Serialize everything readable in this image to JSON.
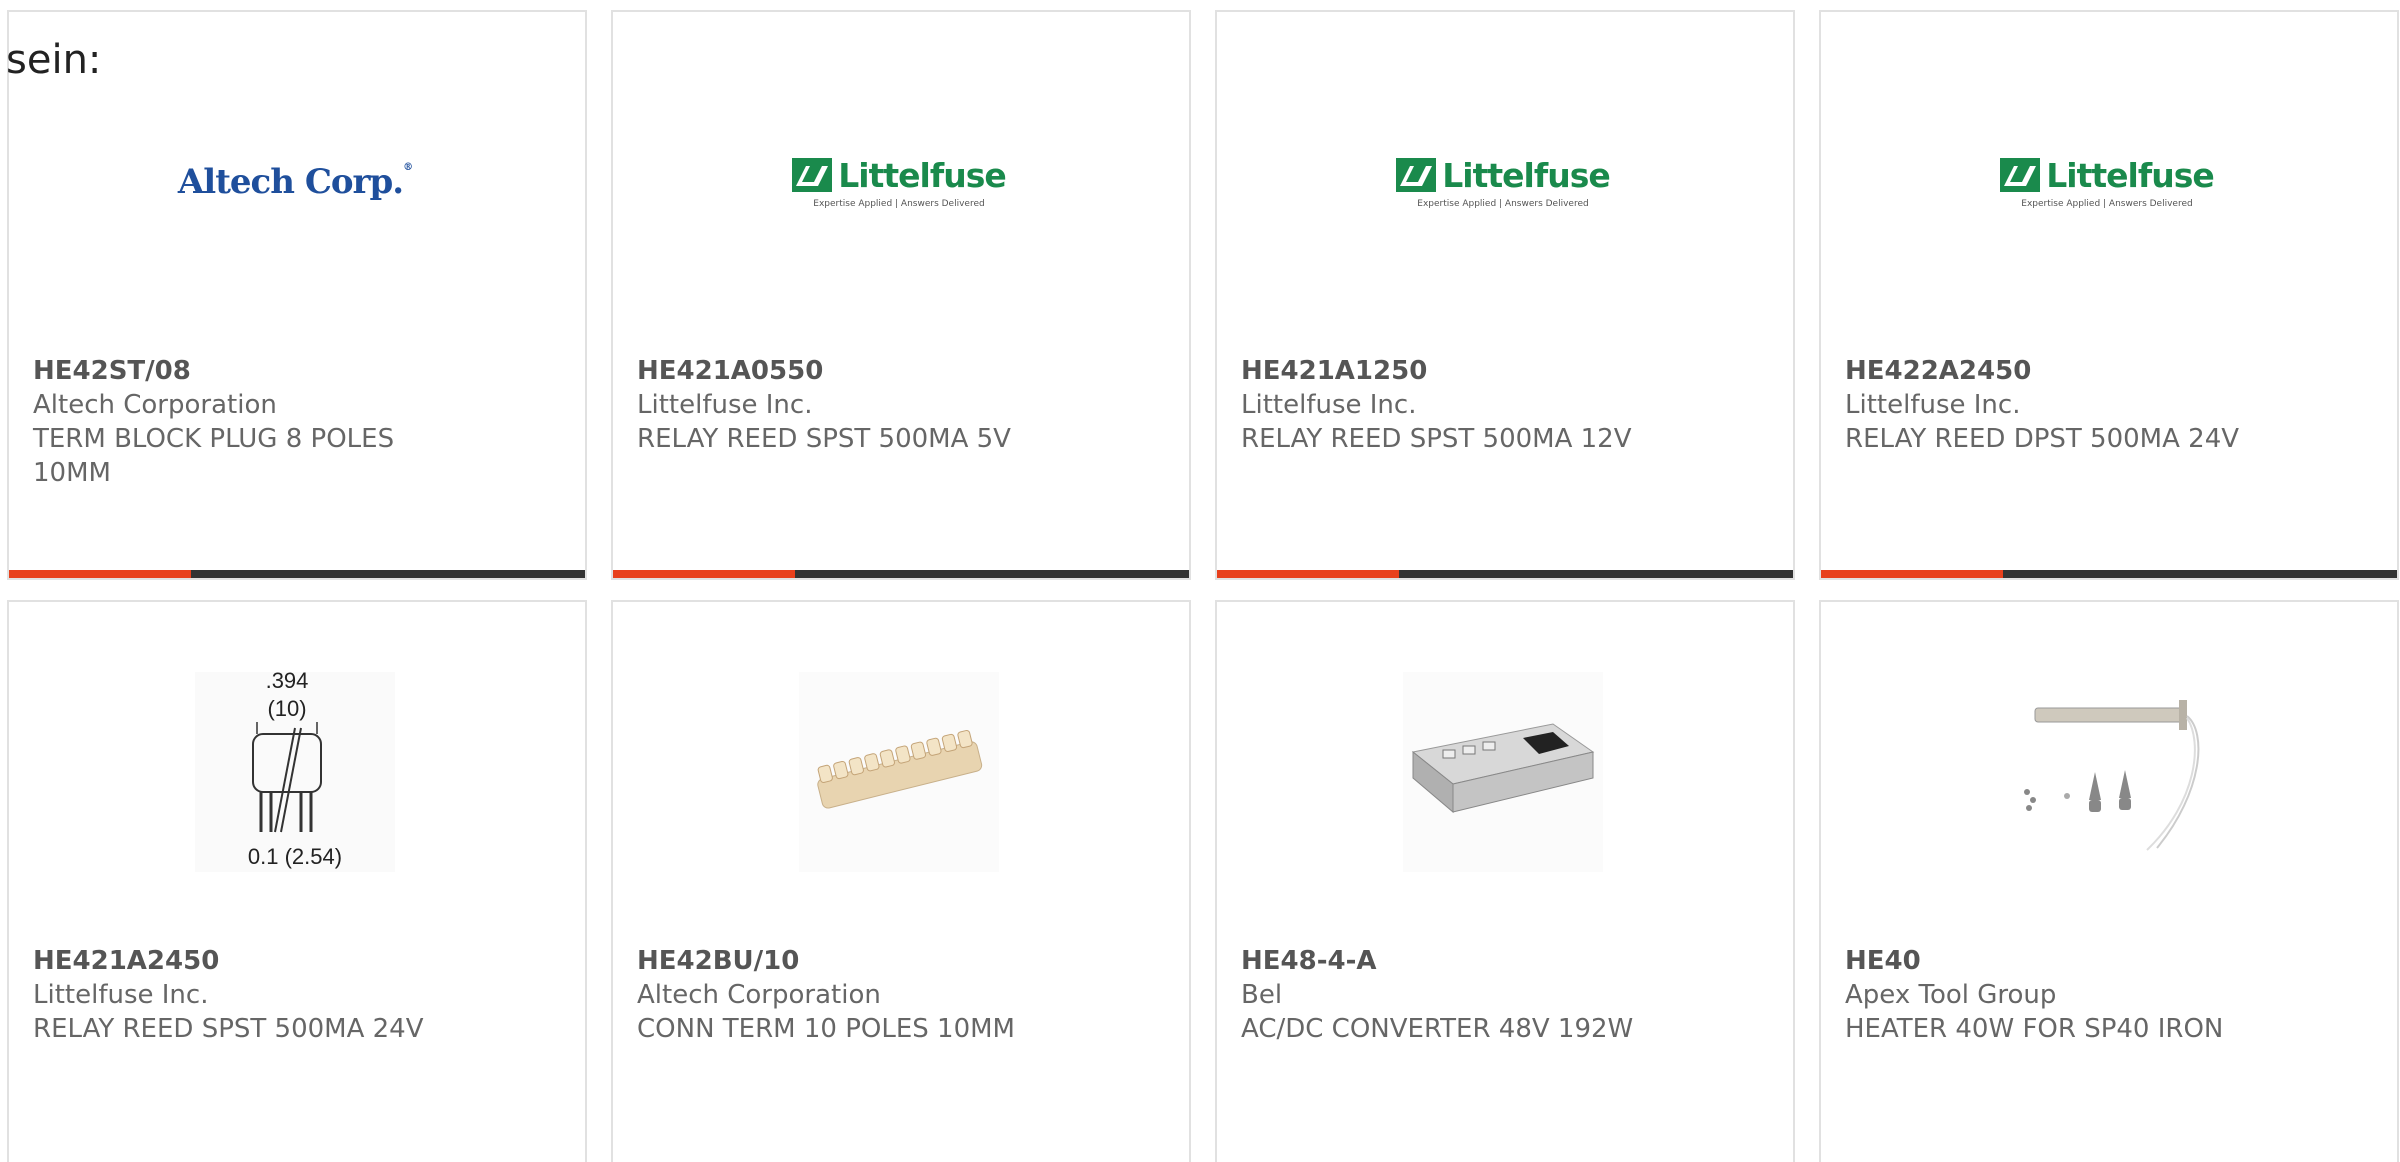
{
  "intro_text": "sein:",
  "colors": {
    "accent": "#e8401c",
    "bar": "#333333",
    "border": "#e1e1e1"
  },
  "products": [
    {
      "part": "HE42ST/08",
      "manufacturer": "Altech Corporation",
      "description": "TERM BLOCK PLUG 8 POLES 10MM",
      "image": "altech-logo",
      "logo_text": "Altech Corp."
    },
    {
      "part": "HE421A0550",
      "manufacturer": "Littelfuse Inc.",
      "description": "RELAY REED SPST 500MA 5V",
      "image": "littelfuse-logo",
      "logo_text": "Littelfuse",
      "logo_tagline": "Expertise Applied | Answers Delivered"
    },
    {
      "part": "HE421A1250",
      "manufacturer": "Littelfuse Inc.",
      "description": "RELAY REED SPST 500MA 12V",
      "image": "littelfuse-logo",
      "logo_text": "Littelfuse",
      "logo_tagline": "Expertise Applied | Answers Delivered"
    },
    {
      "part": "HE422A2450",
      "manufacturer": "Littelfuse Inc.",
      "description": "RELAY REED DPST 500MA 24V",
      "image": "littelfuse-logo",
      "logo_text": "Littelfuse",
      "logo_tagline": "Expertise Applied | Answers Delivered"
    },
    {
      "part": "HE421A2450",
      "manufacturer": "Littelfuse Inc.",
      "description": "RELAY REED SPST 500MA 24V",
      "image": "relay-dimension-drawing",
      "dim_top": ".394",
      "dim_top_mm": "(10)",
      "dim_bottom": "0.1 (2.54)"
    },
    {
      "part": "HE42BU/10",
      "manufacturer": "Altech Corporation",
      "description": "CONN TERM 10 POLES 10MM",
      "image": "terminal-strip-photo"
    },
    {
      "part": "HE48-4-A",
      "manufacturer": "Bel",
      "description": "AC/DC CONVERTER 48V 192W",
      "image": "power-supply-photo"
    },
    {
      "part": "HE40",
      "manufacturer": "Apex Tool Group",
      "description": "HEATER 40W FOR SP40 IRON",
      "image": "heater-element-photo"
    }
  ]
}
